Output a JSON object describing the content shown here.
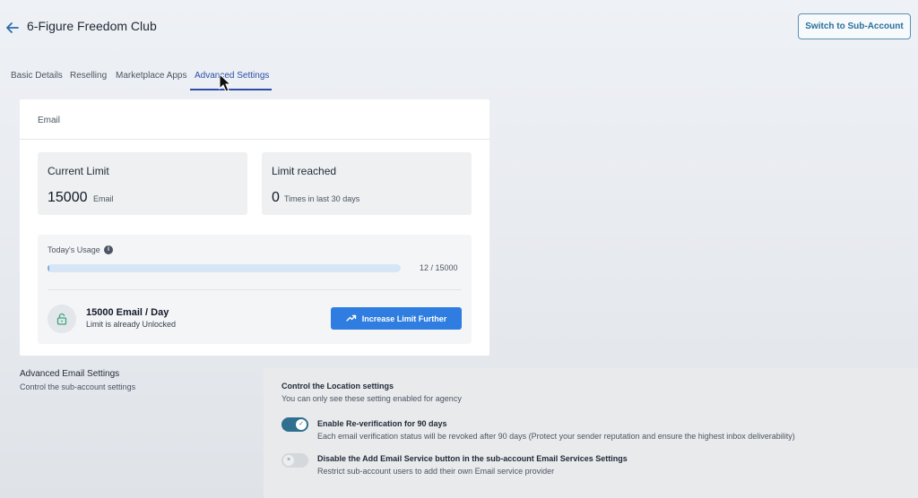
{
  "header": {
    "back_icon": "arrow-left-icon",
    "title": "6-Figure Freedom Club",
    "switch_label": "Switch to Sub-Account"
  },
  "tabs": [
    {
      "label": "Basic Details",
      "active": false
    },
    {
      "label": "Reselling",
      "active": false
    },
    {
      "label": "Marketplace Apps",
      "active": false
    },
    {
      "label": "Advanced Settings",
      "active": true
    }
  ],
  "email_card": {
    "title": "Email",
    "current_limit": {
      "title": "Current Limit",
      "value": "15000",
      "unit": "Email"
    },
    "limit_reached": {
      "title": "Limit reached",
      "value": "0",
      "unit": "Times in last 30 days"
    },
    "usage": {
      "label": "Today's Usage",
      "count": "12 / 15000",
      "used": 12,
      "total": 15000
    },
    "plan": {
      "title": "15000 Email / Day",
      "subtitle": "Limit is already Unlocked",
      "button_label": "Increase Limit Further"
    }
  },
  "advanced": {
    "title": "Advanced Email Settings",
    "subtitle": "Control the sub-account settings"
  },
  "location": {
    "title": "Control the Location settings",
    "subtitle": "You can only see these setting enabled for agency",
    "options": [
      {
        "title": "Enable Re-verification for 90 days",
        "desc": "Each email verification status will be revoked after 90 days (Protect your sender reputation and ensure the highest inbox deliverability)",
        "enabled": true
      },
      {
        "title": "Disable the Add Email Service button in the sub-account Email Services Settings",
        "desc": "Restrict sub-account users to add their own Email service provider",
        "enabled": false
      }
    ]
  },
  "colors": {
    "accent": "#2f7de0",
    "tab_active": "#2b4fa8",
    "toggle_on": "#2f6f8f",
    "lock_icon": "#3aa879"
  }
}
